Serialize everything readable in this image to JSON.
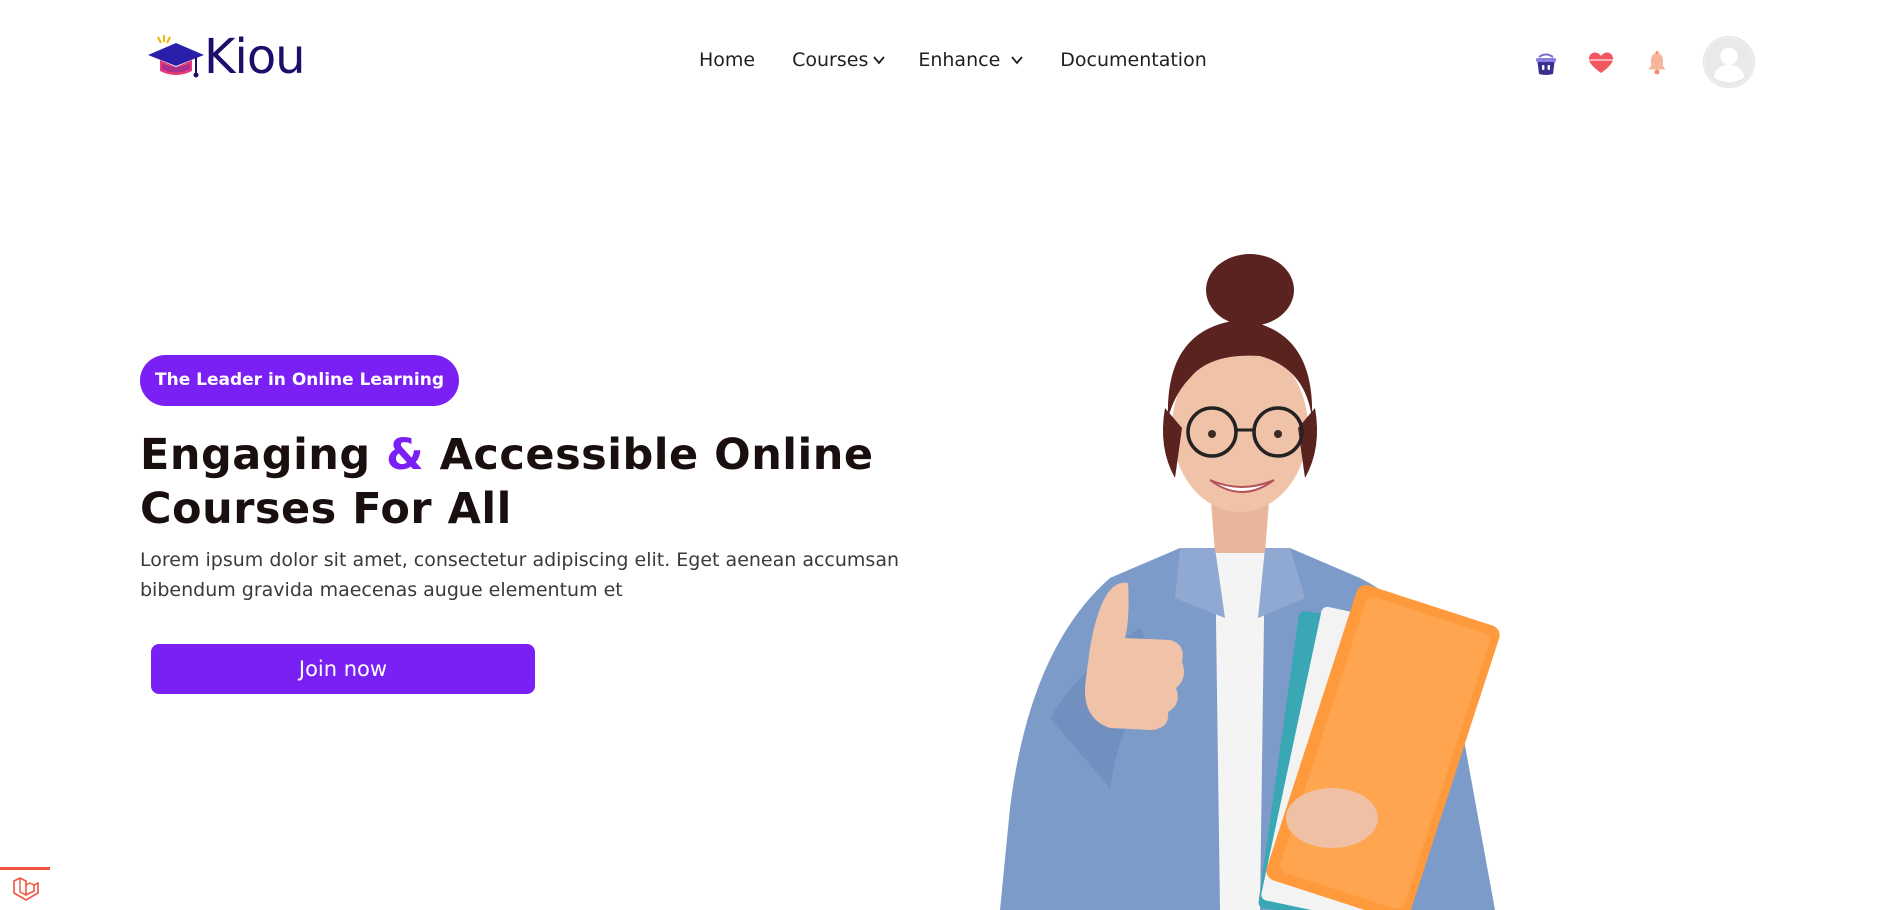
{
  "brand": {
    "name": "Kiou",
    "logo_icon": "graduation-cap-icon"
  },
  "nav": {
    "home": "Home",
    "courses": "Courses",
    "enhance": "Enhance",
    "documentation": "Documentation"
  },
  "header_icons": [
    "cart-icon",
    "heart-icon",
    "bell-icon",
    "user-avatar-icon"
  ],
  "hero": {
    "badge": "The Leader in Online Learning",
    "headline_part1": "Engaging ",
    "headline_amp": "&",
    "headline_part2": " Accessible Online Courses For All",
    "description": "Lorem ipsum dolor sit amet, consectetur adipiscing elit. Eget aenean accumsan bibendum gravida maecenas augue elementum et",
    "cta": "Join now"
  },
  "colors": {
    "accent": "#7b20f5",
    "brand_text": "#1c0f6b",
    "heading": "#1a0f0f",
    "laravel": "#f05340"
  }
}
